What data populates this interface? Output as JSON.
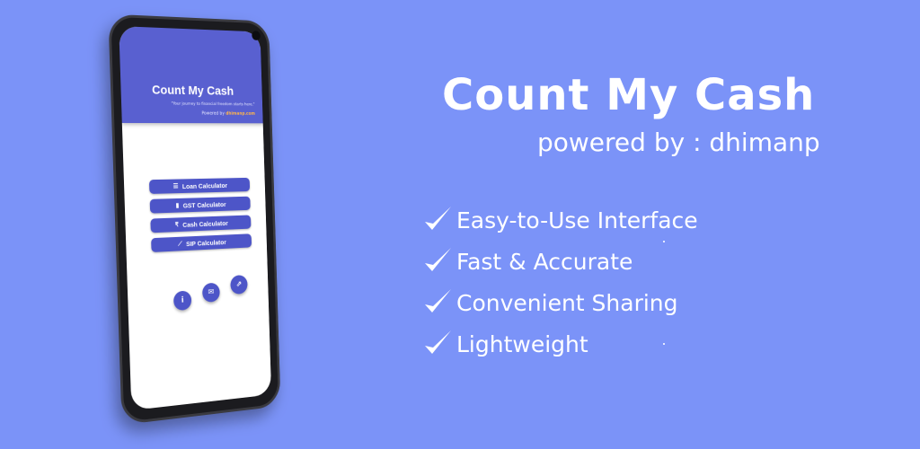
{
  "app": {
    "title": "Count My Cash",
    "tagline": "\"Your journey to financial freedom starts here.\"",
    "powered_prefix": "Powered by",
    "powered_brand": "dhimanp.com",
    "menu": [
      {
        "label": "Loan Calculator",
        "icon": "list-icon"
      },
      {
        "label": "GST Calculator",
        "icon": "document-icon"
      },
      {
        "label": "Cash Calculator",
        "icon": "rupee-icon"
      },
      {
        "label": "SIP Calculator",
        "icon": "chart-icon"
      }
    ],
    "fabs": [
      {
        "icon": "info-icon",
        "glyph": "i"
      },
      {
        "icon": "email-icon",
        "glyph": "✉"
      },
      {
        "icon": "share-icon",
        "glyph": "⇗"
      }
    ]
  },
  "hero": {
    "title": "Count My Cash",
    "subtitle": "powered by : dhimanp"
  },
  "features": [
    "Easy-to-Use Interface",
    "Fast & Accurate",
    "Convenient Sharing",
    "Lightweight"
  ],
  "colors": {
    "background": "#7b93f8",
    "header": "#5960d0",
    "button": "#4d55c8",
    "brand_accent": "#ffb54a"
  }
}
